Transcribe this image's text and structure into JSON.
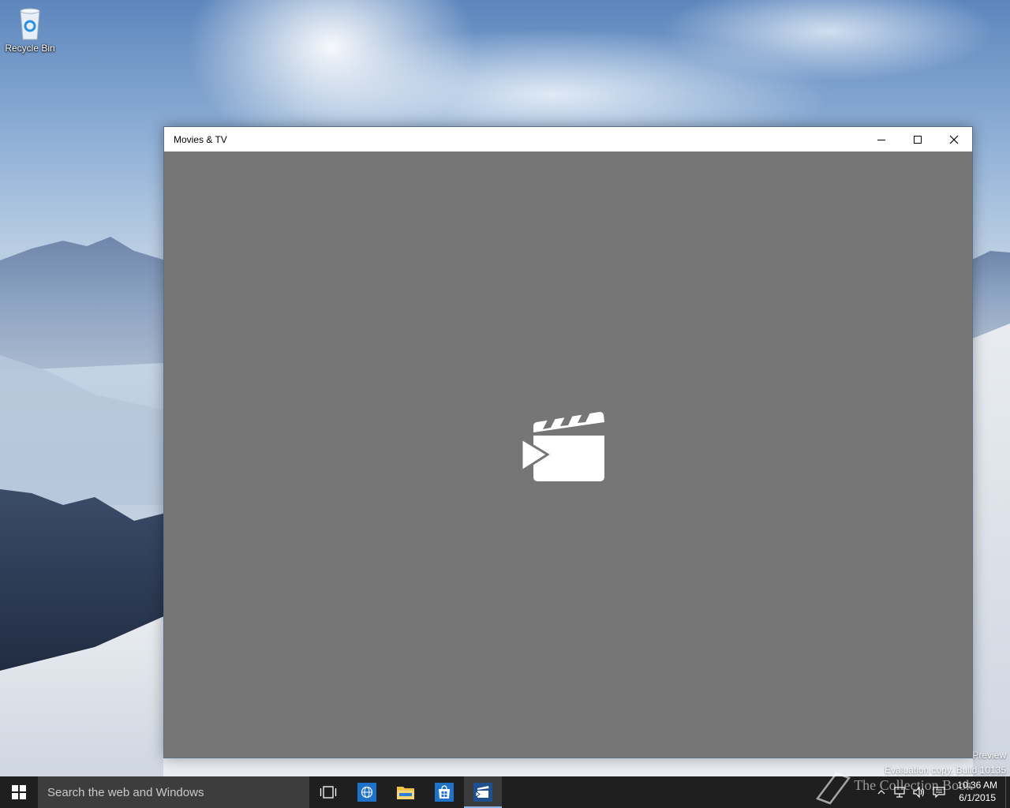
{
  "desktop": {
    "icons": [
      {
        "label": "Recycle Bin",
        "icon": "recycle-bin-icon"
      }
    ],
    "watermark": {
      "line1": "Preview",
      "line2": "Evaluation copy. Build 10135"
    }
  },
  "window": {
    "title": "Movies & TV",
    "controls": {
      "minimize": "minimize-icon",
      "maximize": "maximize-icon",
      "close": "close-icon"
    },
    "splash_icon": "clapperboard-play-icon",
    "background_color": "#767676"
  },
  "taskbar": {
    "search_placeholder": "Search the web and Windows",
    "pinned": [
      {
        "name": "task-view",
        "icon": "task-view-icon"
      },
      {
        "name": "edge",
        "icon": "globe-icon"
      },
      {
        "name": "file-explorer",
        "icon": "folder-icon"
      },
      {
        "name": "store",
        "icon": "store-icon"
      },
      {
        "name": "movies-tv",
        "icon": "clapperboard-icon",
        "active": true
      }
    ],
    "overlay_text": "The Collection Book",
    "clock": {
      "time": "10:36 AM",
      "date": "6/1/2015"
    },
    "accent_color": "#0078d7"
  }
}
